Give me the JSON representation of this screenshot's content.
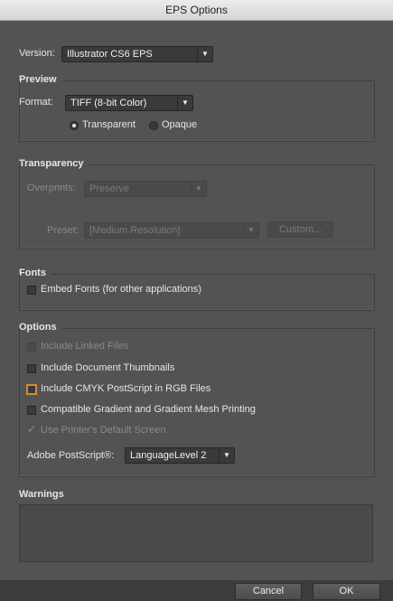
{
  "window": {
    "title": "EPS Options"
  },
  "version": {
    "label": "Version:",
    "value": "Illustrator CS6 EPS"
  },
  "preview": {
    "title": "Preview",
    "format_label": "Format:",
    "format_value": "TIFF (8-bit Color)",
    "transparent_label": "Transparent",
    "opaque_label": "Opaque",
    "selected": "Transparent"
  },
  "transparency": {
    "title": "Transparency",
    "overprints_label": "Overprints:",
    "overprints_value": "Preserve",
    "preset_label": "Preset:",
    "preset_value": "[Medium Resolution]",
    "custom_label": "Custom..."
  },
  "fonts": {
    "title": "Fonts",
    "embed_label": "Embed Fonts (for other applications)",
    "embed_checked": false
  },
  "options": {
    "title": "Options",
    "linked_label": "Include Linked Files",
    "thumbnails_label": "Include Document Thumbnails",
    "cmyk_label": "Include CMYK PostScript in RGB Files",
    "gradient_label": "Compatible Gradient and Gradient Mesh Printing",
    "printer_label": "Use Printer's Default Screen",
    "printer_checked": true,
    "postscript_label": "Adobe PostScript®:",
    "postscript_value": "LanguageLevel 2"
  },
  "warnings": {
    "title": "Warnings"
  },
  "buttons": {
    "cancel": "Cancel",
    "ok": "OK"
  }
}
